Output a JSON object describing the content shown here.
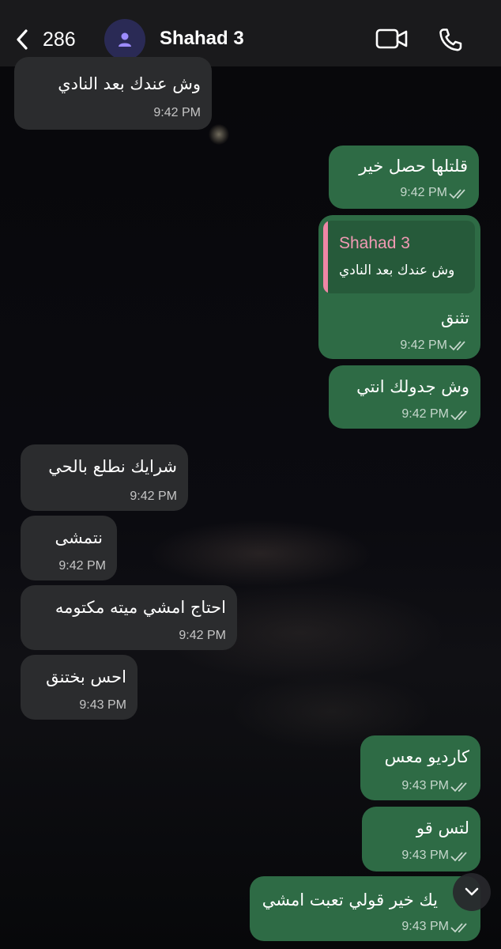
{
  "header": {
    "back_count": "286",
    "contact_name": "Shahad 3"
  },
  "messages": [
    {
      "id": 1,
      "direction": "in",
      "text": "وش عندك بعد النادي",
      "time": "9:42 PM"
    },
    {
      "id": 2,
      "direction": "out",
      "text": "قلتلها حصل خير",
      "time": "9:42 PM",
      "status": "read"
    },
    {
      "id": 3,
      "direction": "out",
      "text": "تثنق",
      "time": "9:42 PM",
      "status": "read",
      "reply": {
        "name": "Shahad 3",
        "text": "وش عندك بعد النادي"
      }
    },
    {
      "id": 4,
      "direction": "out",
      "text": "وش جدولك انتي",
      "time": "9:42 PM",
      "status": "read"
    },
    {
      "id": 5,
      "direction": "in",
      "text": "شرايك نطلع بالحي",
      "time": "9:42 PM"
    },
    {
      "id": 6,
      "direction": "in",
      "text": "نتمشى",
      "time": "9:42 PM"
    },
    {
      "id": 7,
      "direction": "in",
      "text": "احتاج امشي ميته مكتومه",
      "time": "9:42 PM"
    },
    {
      "id": 8,
      "direction": "in",
      "text": "احس بختنق",
      "time": "9:43 PM"
    },
    {
      "id": 9,
      "direction": "out",
      "text": "كارديو معس",
      "time": "9:43 PM",
      "status": "read"
    },
    {
      "id": 10,
      "direction": "out",
      "text": "لتس قو",
      "time": "9:43 PM",
      "status": "read"
    },
    {
      "id": 11,
      "direction": "out",
      "text": "يك خير قولي تعبت امشي",
      "time": "9:43 PM",
      "status": "read"
    }
  ],
  "colors": {
    "incoming_bubble": "#2b2c2e",
    "outgoing_bubble": "#2e6b45",
    "reply_accent": "#ef86a6",
    "avatar_bg": "#2a2a55",
    "avatar_icon": "#9d8cff"
  },
  "icons": {
    "back": "chevron-left-icon",
    "avatar": "person-icon",
    "video": "video-camera-icon",
    "call": "phone-icon",
    "read_status": "double-check-icon",
    "scroll_down": "chevron-down-icon"
  }
}
